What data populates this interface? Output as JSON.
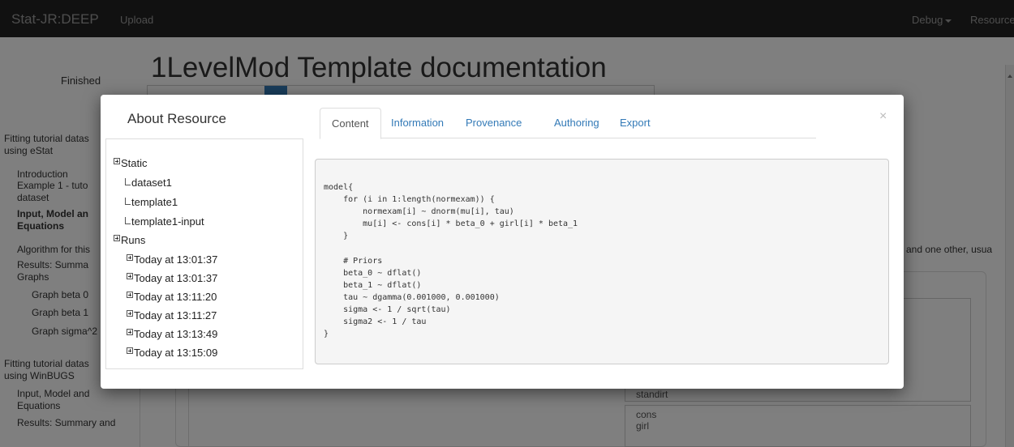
{
  "navbar": {
    "brand": "Stat-JR:DEEP",
    "upload": "Upload",
    "debug": "Debug",
    "resources": "Resources"
  },
  "background": {
    "status": "Finished",
    "title": "1LevelMod Template documentation",
    "side_text": "and one other, usua",
    "listbox1_last": "standirt",
    "listbox2_items": [
      "cons",
      "girl"
    ],
    "tree": [
      {
        "label": "Fitting tutorial datas",
        "level": 0
      },
      {
        "label": "using eStat",
        "level": 0
      },
      {
        "label": "Introduction",
        "level": 1
      },
      {
        "label": "Example 1 - tuto",
        "level": 1
      },
      {
        "label": "dataset",
        "level": 1
      },
      {
        "label": "Input, Model an",
        "level": 1
      },
      {
        "label": "Equations",
        "level": 1
      },
      {
        "label": "Algorithm for this",
        "level": 1
      },
      {
        "label": "Results: Summa",
        "level": 1
      },
      {
        "label": "Graphs",
        "level": 1
      },
      {
        "label": "Graph beta 0",
        "level": 2
      },
      {
        "label": "Graph beta 1",
        "level": 2
      },
      {
        "label": "Graph sigma^2",
        "level": 2
      },
      {
        "label": "Fitting tutorial datas",
        "level": 0
      },
      {
        "label": "using WinBUGS",
        "level": 0
      },
      {
        "label": "Input, Model and",
        "level": 1
      },
      {
        "label": "Equations",
        "level": 1
      },
      {
        "label": "Results: Summary and",
        "level": 1
      }
    ]
  },
  "modal": {
    "title": "About Resource",
    "close": "×",
    "tabs": [
      "Content",
      "Information",
      "Provenance",
      "Authoring",
      "Export"
    ],
    "active_tab": "Content",
    "resource_tree": {
      "static_label": "Static",
      "static_items": [
        "dataset1",
        "template1",
        "template1-input"
      ],
      "runs_label": "Runs",
      "runs": [
        "Today at 13:01:37",
        "Today at 13:01:37",
        "Today at 13:11:20",
        "Today at 13:11:27",
        "Today at 13:13:49",
        "Today at 13:15:09"
      ]
    },
    "code": "model{\n    for (i in 1:length(normexam)) {\n        normexam[i] ~ dnorm(mu[i], tau)\n        mu[i] <- cons[i] * beta_0 + girl[i] * beta_1\n    }\n\n    # Priors\n    beta_0 ~ dflat()\n    beta_1 ~ dflat()\n    tau ~ dgamma(0.001000, 0.001000)\n    sigma <- 1 / sqrt(tau)\n    sigma2 <- 1 / tau\n}"
  },
  "colors": {
    "navbar_bg": "#222222",
    "link": "#337ab7",
    "backdrop": "rgba(0,0,0,0.5)"
  }
}
